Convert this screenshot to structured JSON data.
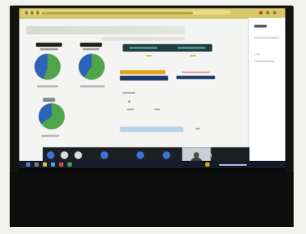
{
  "photo": {
    "subject": "",
    "colors": {
      "browser_bar": "#d8c86a",
      "pie_blue": "#2d63b8",
      "pie_green": "#4ea54a",
      "dark_bar": "#1f3f43",
      "orange_bar": "#e0a41e",
      "navy_bar": "#1e3b6f",
      "call_bar": "#1c2024",
      "taskbar": "#151b2a"
    }
  },
  "chart_data": [
    {
      "type": "pie",
      "slices": [
        {
          "value": 0.55,
          "color": "#4ea54a"
        },
        {
          "value": 0.45,
          "color": "#2d63b8"
        }
      ]
    },
    {
      "type": "pie",
      "slices": [
        {
          "value": 0.6,
          "color": "#4ea54a"
        },
        {
          "value": 0.4,
          "color": "#2d63b8"
        }
      ]
    },
    {
      "type": "pie",
      "slices": [
        {
          "value": 0.65,
          "color": "#4ea54a"
        },
        {
          "value": 0.35,
          "color": "#2d63b8"
        }
      ]
    }
  ]
}
